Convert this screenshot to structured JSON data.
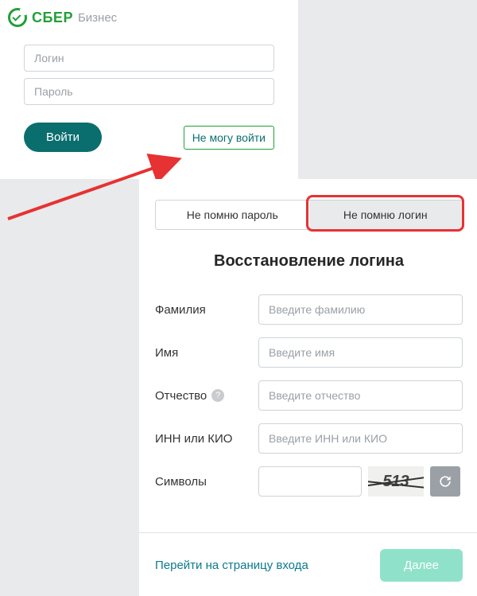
{
  "logo": {
    "brand": "СБЕР",
    "sub": "Бизнес"
  },
  "login": {
    "login_placeholder": "Логин",
    "password_placeholder": "Пароль",
    "submit_label": "Войти",
    "cant_login_label": "Не могу войти"
  },
  "recovery": {
    "tabs": {
      "password": "Не помню пароль",
      "login": "Не помню логин"
    },
    "title": "Восстановление логина",
    "fields": {
      "surname": {
        "label": "Фамилия",
        "placeholder": "Введите фамилию"
      },
      "name": {
        "label": "Имя",
        "placeholder": "Введите имя"
      },
      "patronymic": {
        "label": "Отчество",
        "placeholder": "Введите отчество"
      },
      "inn": {
        "label": "ИНН или КИО",
        "placeholder": "Введите ИНН или КИО"
      },
      "captcha": {
        "label": "Символы",
        "value": "513"
      }
    },
    "footer": {
      "back": "Перейти на страницу входа",
      "next": "Далее"
    }
  }
}
